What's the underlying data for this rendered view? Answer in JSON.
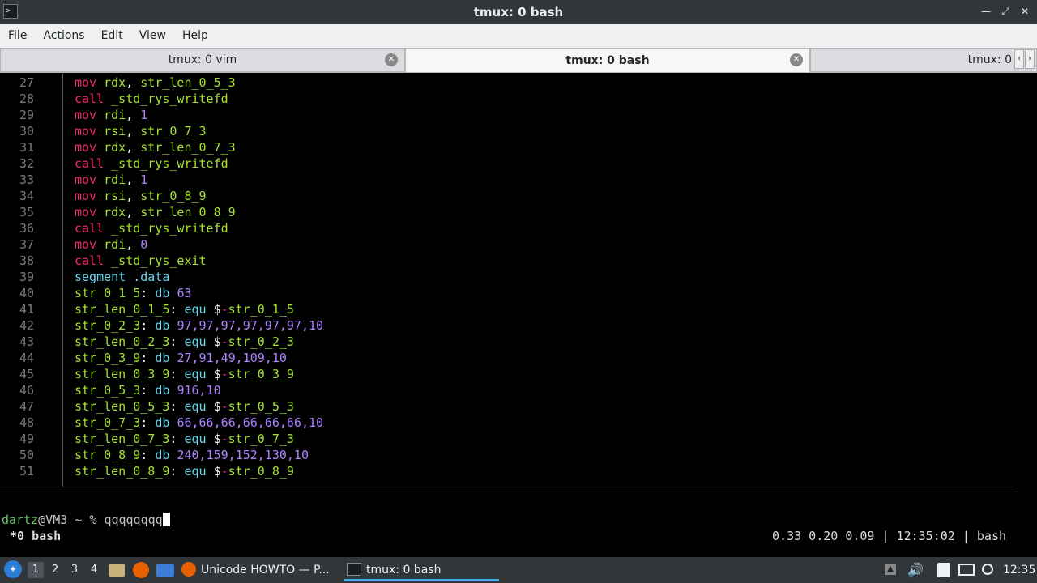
{
  "window": {
    "title": "tmux: 0 bash"
  },
  "menu": [
    "File",
    "Actions",
    "Edit",
    "View",
    "Help"
  ],
  "tabs": [
    {
      "label": "tmux: 0 vim",
      "active": false
    },
    {
      "label": "tmux: 0 bash",
      "active": true
    },
    {
      "label": "tmux: 0",
      "active": false
    }
  ],
  "code_lines": [
    {
      "n": "27",
      "t": [
        [
          "kw",
          "mov"
        ],
        [
          "plain",
          " "
        ],
        [
          "reg",
          "rdx"
        ],
        [
          "plain",
          ", "
        ],
        [
          "lbl",
          "str_len_0_5_3"
        ]
      ]
    },
    {
      "n": "28",
      "t": [
        [
          "kw",
          "call"
        ],
        [
          "plain",
          " "
        ],
        [
          "lbl",
          "_std_rys_writefd"
        ]
      ]
    },
    {
      "n": "29",
      "t": [
        [
          "kw",
          "mov"
        ],
        [
          "plain",
          " "
        ],
        [
          "reg",
          "rdi"
        ],
        [
          "plain",
          ", "
        ],
        [
          "num",
          "1"
        ]
      ]
    },
    {
      "n": "30",
      "t": [
        [
          "kw",
          "mov"
        ],
        [
          "plain",
          " "
        ],
        [
          "reg",
          "rsi"
        ],
        [
          "plain",
          ", "
        ],
        [
          "lbl",
          "str_0_7_3"
        ]
      ]
    },
    {
      "n": "31",
      "t": [
        [
          "kw",
          "mov"
        ],
        [
          "plain",
          " "
        ],
        [
          "reg",
          "rdx"
        ],
        [
          "plain",
          ", "
        ],
        [
          "lbl",
          "str_len_0_7_3"
        ]
      ]
    },
    {
      "n": "32",
      "t": [
        [
          "kw",
          "call"
        ],
        [
          "plain",
          " "
        ],
        [
          "lbl",
          "_std_rys_writefd"
        ]
      ]
    },
    {
      "n": "33",
      "t": [
        [
          "kw",
          "mov"
        ],
        [
          "plain",
          " "
        ],
        [
          "reg",
          "rdi"
        ],
        [
          "plain",
          ", "
        ],
        [
          "num",
          "1"
        ]
      ]
    },
    {
      "n": "34",
      "t": [
        [
          "kw",
          "mov"
        ],
        [
          "plain",
          " "
        ],
        [
          "reg",
          "rsi"
        ],
        [
          "plain",
          ", "
        ],
        [
          "lbl",
          "str_0_8_9"
        ]
      ]
    },
    {
      "n": "35",
      "t": [
        [
          "kw",
          "mov"
        ],
        [
          "plain",
          " "
        ],
        [
          "reg",
          "rdx"
        ],
        [
          "plain",
          ", "
        ],
        [
          "lbl",
          "str_len_0_8_9"
        ]
      ]
    },
    {
      "n": "36",
      "t": [
        [
          "kw",
          "call"
        ],
        [
          "plain",
          " "
        ],
        [
          "lbl",
          "_std_rys_writefd"
        ]
      ]
    },
    {
      "n": "37",
      "t": [
        [
          "kw",
          "mov"
        ],
        [
          "plain",
          " "
        ],
        [
          "reg",
          "rdi"
        ],
        [
          "plain",
          ", "
        ],
        [
          "num",
          "0"
        ]
      ]
    },
    {
      "n": "38",
      "t": [
        [
          "kw",
          "call"
        ],
        [
          "plain",
          " "
        ],
        [
          "lbl",
          "_std_rys_exit"
        ]
      ]
    },
    {
      "n": "39",
      "t": [
        [
          "dir",
          "segment .data"
        ]
      ]
    },
    {
      "n": "40",
      "t": [
        [
          "lbl",
          "str_0_1_5"
        ],
        [
          "plain",
          ": "
        ],
        [
          "dir",
          "db"
        ],
        [
          "plain",
          " "
        ],
        [
          "num",
          "63"
        ]
      ]
    },
    {
      "n": "41",
      "t": [
        [
          "lbl",
          "str_len_0_1_5"
        ],
        [
          "plain",
          ": "
        ],
        [
          "dir",
          "equ"
        ],
        [
          "plain",
          " $"
        ],
        [
          "kw",
          "-"
        ],
        [
          "lbl",
          "str_0_1_5"
        ]
      ]
    },
    {
      "n": "42",
      "t": [
        [
          "lbl",
          "str_0_2_3"
        ],
        [
          "plain",
          ": "
        ],
        [
          "dir",
          "db"
        ],
        [
          "plain",
          " "
        ],
        [
          "num",
          "97,97,97,97,97,97,10"
        ]
      ]
    },
    {
      "n": "43",
      "t": [
        [
          "lbl",
          "str_len_0_2_3"
        ],
        [
          "plain",
          ": "
        ],
        [
          "dir",
          "equ"
        ],
        [
          "plain",
          " $"
        ],
        [
          "kw",
          "-"
        ],
        [
          "lbl",
          "str_0_2_3"
        ]
      ]
    },
    {
      "n": "44",
      "t": [
        [
          "lbl",
          "str_0_3_9"
        ],
        [
          "plain",
          ": "
        ],
        [
          "dir",
          "db"
        ],
        [
          "plain",
          " "
        ],
        [
          "num",
          "27,91,49,109,10"
        ]
      ]
    },
    {
      "n": "45",
      "t": [
        [
          "lbl",
          "str_len_0_3_9"
        ],
        [
          "plain",
          ": "
        ],
        [
          "dir",
          "equ"
        ],
        [
          "plain",
          " $"
        ],
        [
          "kw",
          "-"
        ],
        [
          "lbl",
          "str_0_3_9"
        ]
      ]
    },
    {
      "n": "46",
      "t": [
        [
          "lbl",
          "str_0_5_3"
        ],
        [
          "plain",
          ": "
        ],
        [
          "dir",
          "db"
        ],
        [
          "plain",
          " "
        ],
        [
          "num",
          "916,10"
        ]
      ]
    },
    {
      "n": "47",
      "t": [
        [
          "lbl",
          "str_len_0_5_3"
        ],
        [
          "plain",
          ": "
        ],
        [
          "dir",
          "equ"
        ],
        [
          "plain",
          " $"
        ],
        [
          "kw",
          "-"
        ],
        [
          "lbl",
          "str_0_5_3"
        ]
      ]
    },
    {
      "n": "48",
      "t": [
        [
          "lbl",
          "str_0_7_3"
        ],
        [
          "plain",
          ": "
        ],
        [
          "dir",
          "db"
        ],
        [
          "plain",
          " "
        ],
        [
          "num",
          "66,66,66,66,66,66,10"
        ]
      ]
    },
    {
      "n": "49",
      "t": [
        [
          "lbl",
          "str_len_0_7_3"
        ],
        [
          "plain",
          ": "
        ],
        [
          "dir",
          "equ"
        ],
        [
          "plain",
          " $"
        ],
        [
          "kw",
          "-"
        ],
        [
          "lbl",
          "str_0_7_3"
        ]
      ]
    },
    {
      "n": "50",
      "t": [
        [
          "lbl",
          "str_0_8_9"
        ],
        [
          "plain",
          ": "
        ],
        [
          "dir",
          "db"
        ],
        [
          "plain",
          " "
        ],
        [
          "num",
          "240,159,152,130,10"
        ]
      ]
    },
    {
      "n": "51",
      "t": [
        [
          "lbl",
          "str_len_0_8_9"
        ],
        [
          "plain",
          ": "
        ],
        [
          "dir",
          "equ"
        ],
        [
          "plain",
          " $"
        ],
        [
          "kw",
          "-"
        ],
        [
          "lbl",
          "str_0_8_9"
        ]
      ]
    }
  ],
  "prompt": {
    "user": "dartz",
    "host": "@VM3 ~ % ",
    "input": "qqqqqqqq"
  },
  "status": {
    "window": "*0 bash",
    "right": "0.33 0.20 0.09 | 12:35:02 | bash"
  },
  "taskbar": {
    "desktops": [
      "1",
      "2",
      "3",
      "4"
    ],
    "tasks": [
      {
        "label": "Unicode HOWTO — P...",
        "active": false
      },
      {
        "label": "tmux: 0 bash",
        "active": true
      }
    ],
    "clock": "12:35"
  },
  "colors": {
    "keyword": "#f92672",
    "register": "#a6e22e",
    "number": "#ae81ff",
    "directive": "#66d9ef"
  }
}
